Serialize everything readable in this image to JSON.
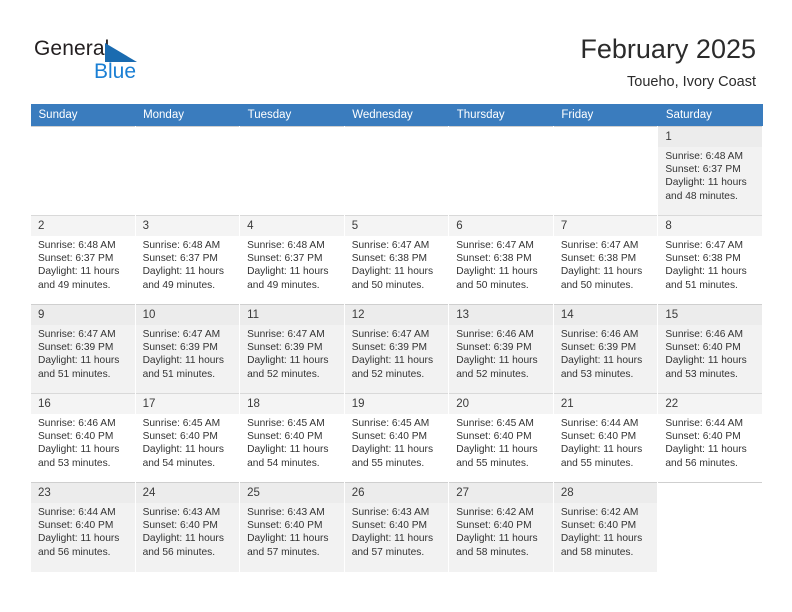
{
  "brand": {
    "name_part1": "General",
    "name_part2": "Blue",
    "triangle_color": "#1a6bb0",
    "blue_text_color": "#1a7fd4"
  },
  "header": {
    "title": "February 2025",
    "subtitle": "Toueho, Ivory Coast",
    "header_bg_color": "#3a7cbe",
    "header_text_color": "#ffffff"
  },
  "columns": [
    "Sunday",
    "Monday",
    "Tuesday",
    "Wednesday",
    "Thursday",
    "Friday",
    "Saturday"
  ],
  "labels": {
    "sunrise": "Sunrise:",
    "sunset": "Sunset:",
    "daylight": "Daylight:"
  },
  "weeks": [
    [
      {
        "empty": true
      },
      {
        "empty": true
      },
      {
        "empty": true
      },
      {
        "empty": true
      },
      {
        "empty": true
      },
      {
        "empty": true
      },
      {
        "day": "1",
        "sunrise": "Sunrise: 6:48 AM",
        "sunset": "Sunset: 6:37 PM",
        "daylight_line1": "Daylight: 11 hours",
        "daylight_line2": "and 48 minutes."
      }
    ],
    [
      {
        "day": "2",
        "sunrise": "Sunrise: 6:48 AM",
        "sunset": "Sunset: 6:37 PM",
        "daylight_line1": "Daylight: 11 hours",
        "daylight_line2": "and 49 minutes."
      },
      {
        "day": "3",
        "sunrise": "Sunrise: 6:48 AM",
        "sunset": "Sunset: 6:37 PM",
        "daylight_line1": "Daylight: 11 hours",
        "daylight_line2": "and 49 minutes."
      },
      {
        "day": "4",
        "sunrise": "Sunrise: 6:48 AM",
        "sunset": "Sunset: 6:37 PM",
        "daylight_line1": "Daylight: 11 hours",
        "daylight_line2": "and 49 minutes."
      },
      {
        "day": "5",
        "sunrise": "Sunrise: 6:47 AM",
        "sunset": "Sunset: 6:38 PM",
        "daylight_line1": "Daylight: 11 hours",
        "daylight_line2": "and 50 minutes."
      },
      {
        "day": "6",
        "sunrise": "Sunrise: 6:47 AM",
        "sunset": "Sunset: 6:38 PM",
        "daylight_line1": "Daylight: 11 hours",
        "daylight_line2": "and 50 minutes."
      },
      {
        "day": "7",
        "sunrise": "Sunrise: 6:47 AM",
        "sunset": "Sunset: 6:38 PM",
        "daylight_line1": "Daylight: 11 hours",
        "daylight_line2": "and 50 minutes."
      },
      {
        "day": "8",
        "sunrise": "Sunrise: 6:47 AM",
        "sunset": "Sunset: 6:38 PM",
        "daylight_line1": "Daylight: 11 hours",
        "daylight_line2": "and 51 minutes."
      }
    ],
    [
      {
        "day": "9",
        "sunrise": "Sunrise: 6:47 AM",
        "sunset": "Sunset: 6:39 PM",
        "daylight_line1": "Daylight: 11 hours",
        "daylight_line2": "and 51 minutes."
      },
      {
        "day": "10",
        "sunrise": "Sunrise: 6:47 AM",
        "sunset": "Sunset: 6:39 PM",
        "daylight_line1": "Daylight: 11 hours",
        "daylight_line2": "and 51 minutes."
      },
      {
        "day": "11",
        "sunrise": "Sunrise: 6:47 AM",
        "sunset": "Sunset: 6:39 PM",
        "daylight_line1": "Daylight: 11 hours",
        "daylight_line2": "and 52 minutes."
      },
      {
        "day": "12",
        "sunrise": "Sunrise: 6:47 AM",
        "sunset": "Sunset: 6:39 PM",
        "daylight_line1": "Daylight: 11 hours",
        "daylight_line2": "and 52 minutes."
      },
      {
        "day": "13",
        "sunrise": "Sunrise: 6:46 AM",
        "sunset": "Sunset: 6:39 PM",
        "daylight_line1": "Daylight: 11 hours",
        "daylight_line2": "and 52 minutes."
      },
      {
        "day": "14",
        "sunrise": "Sunrise: 6:46 AM",
        "sunset": "Sunset: 6:39 PM",
        "daylight_line1": "Daylight: 11 hours",
        "daylight_line2": "and 53 minutes."
      },
      {
        "day": "15",
        "sunrise": "Sunrise: 6:46 AM",
        "sunset": "Sunset: 6:40 PM",
        "daylight_line1": "Daylight: 11 hours",
        "daylight_line2": "and 53 minutes."
      }
    ],
    [
      {
        "day": "16",
        "sunrise": "Sunrise: 6:46 AM",
        "sunset": "Sunset: 6:40 PM",
        "daylight_line1": "Daylight: 11 hours",
        "daylight_line2": "and 53 minutes."
      },
      {
        "day": "17",
        "sunrise": "Sunrise: 6:45 AM",
        "sunset": "Sunset: 6:40 PM",
        "daylight_line1": "Daylight: 11 hours",
        "daylight_line2": "and 54 minutes."
      },
      {
        "day": "18",
        "sunrise": "Sunrise: 6:45 AM",
        "sunset": "Sunset: 6:40 PM",
        "daylight_line1": "Daylight: 11 hours",
        "daylight_line2": "and 54 minutes."
      },
      {
        "day": "19",
        "sunrise": "Sunrise: 6:45 AM",
        "sunset": "Sunset: 6:40 PM",
        "daylight_line1": "Daylight: 11 hours",
        "daylight_line2": "and 55 minutes."
      },
      {
        "day": "20",
        "sunrise": "Sunrise: 6:45 AM",
        "sunset": "Sunset: 6:40 PM",
        "daylight_line1": "Daylight: 11 hours",
        "daylight_line2": "and 55 minutes."
      },
      {
        "day": "21",
        "sunrise": "Sunrise: 6:44 AM",
        "sunset": "Sunset: 6:40 PM",
        "daylight_line1": "Daylight: 11 hours",
        "daylight_line2": "and 55 minutes."
      },
      {
        "day": "22",
        "sunrise": "Sunrise: 6:44 AM",
        "sunset": "Sunset: 6:40 PM",
        "daylight_line1": "Daylight: 11 hours",
        "daylight_line2": "and 56 minutes."
      }
    ],
    [
      {
        "day": "23",
        "sunrise": "Sunrise: 6:44 AM",
        "sunset": "Sunset: 6:40 PM",
        "daylight_line1": "Daylight: 11 hours",
        "daylight_line2": "and 56 minutes."
      },
      {
        "day": "24",
        "sunrise": "Sunrise: 6:43 AM",
        "sunset": "Sunset: 6:40 PM",
        "daylight_line1": "Daylight: 11 hours",
        "daylight_line2": "and 56 minutes."
      },
      {
        "day": "25",
        "sunrise": "Sunrise: 6:43 AM",
        "sunset": "Sunset: 6:40 PM",
        "daylight_line1": "Daylight: 11 hours",
        "daylight_line2": "and 57 minutes."
      },
      {
        "day": "26",
        "sunrise": "Sunrise: 6:43 AM",
        "sunset": "Sunset: 6:40 PM",
        "daylight_line1": "Daylight: 11 hours",
        "daylight_line2": "and 57 minutes."
      },
      {
        "day": "27",
        "sunrise": "Sunrise: 6:42 AM",
        "sunset": "Sunset: 6:40 PM",
        "daylight_line1": "Daylight: 11 hours",
        "daylight_line2": "and 58 minutes."
      },
      {
        "day": "28",
        "sunrise": "Sunrise: 6:42 AM",
        "sunset": "Sunset: 6:40 PM",
        "daylight_line1": "Daylight: 11 hours",
        "daylight_line2": "and 58 minutes."
      },
      {
        "empty": true
      }
    ]
  ]
}
